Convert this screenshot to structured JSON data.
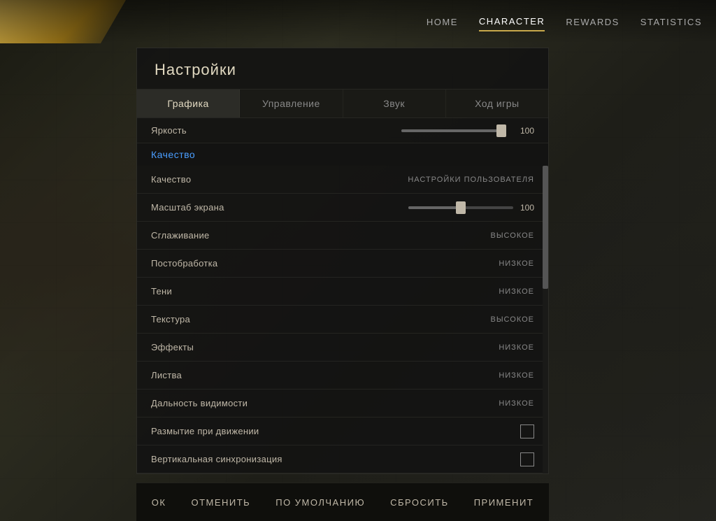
{
  "nav": {
    "items": [
      {
        "id": "home",
        "label": "HOME",
        "active": false
      },
      {
        "id": "character",
        "label": "CHARACTER",
        "active": true
      },
      {
        "id": "rewards",
        "label": "REWARDS",
        "active": false
      },
      {
        "id": "statistics",
        "label": "STATISTICS",
        "active": false
      }
    ]
  },
  "settings": {
    "title": "Настройки",
    "tabs": [
      {
        "id": "graphics",
        "label": "Графика",
        "active": true
      },
      {
        "id": "controls",
        "label": "Управление",
        "active": false
      },
      {
        "id": "sound",
        "label": "Звук",
        "active": false
      },
      {
        "id": "gameplay",
        "label": "Ход игры",
        "active": false
      }
    ],
    "sections": {
      "brightness": {
        "label": "Яркость",
        "value": 100,
        "slider_fill_pct": 100
      },
      "quality_section_label": "Качество",
      "rows": [
        {
          "id": "quality",
          "label": "Качество",
          "value": "НАСТРОЙКИ ПОЛЬЗОВАТЕЛЯ",
          "type": "text"
        },
        {
          "id": "scale",
          "label": "Масштаб экрана",
          "value": 100,
          "type": "slider_mid"
        },
        {
          "id": "antialiasing",
          "label": "Сглаживание",
          "value": "ВЫСОКОЕ",
          "type": "text"
        },
        {
          "id": "postprocessing",
          "label": "Постобработка",
          "value": "НИЗКОЕ",
          "type": "text"
        },
        {
          "id": "shadows",
          "label": "Тени",
          "value": "НИЗКОЕ",
          "type": "text"
        },
        {
          "id": "texture",
          "label": "Текстура",
          "value": "ВЫСОКОЕ",
          "type": "text"
        },
        {
          "id": "effects",
          "label": "Эффекты",
          "value": "НИЗКОЕ",
          "type": "text"
        },
        {
          "id": "foliage",
          "label": "Листва",
          "value": "НИЗКОЕ",
          "type": "text"
        },
        {
          "id": "view_distance",
          "label": "Дальность видимости",
          "value": "НИЗКОЕ",
          "type": "text"
        },
        {
          "id": "motion_blur",
          "label": "Размытие при движении",
          "value": "",
          "type": "checkbox",
          "checked": false
        },
        {
          "id": "vsync",
          "label": "Вертикальная синхронизация",
          "value": "",
          "type": "checkbox",
          "checked": false
        }
      ]
    }
  },
  "actions": {
    "buttons": [
      {
        "id": "ok",
        "label": "ОК"
      },
      {
        "id": "cancel",
        "label": "ОТМЕНИТЬ"
      },
      {
        "id": "default",
        "label": "ПО УМОЛЧАНИЮ"
      },
      {
        "id": "reset",
        "label": "СБРОСИТЬ"
      },
      {
        "id": "apply",
        "label": "ПРИМЕНИТ"
      }
    ]
  }
}
